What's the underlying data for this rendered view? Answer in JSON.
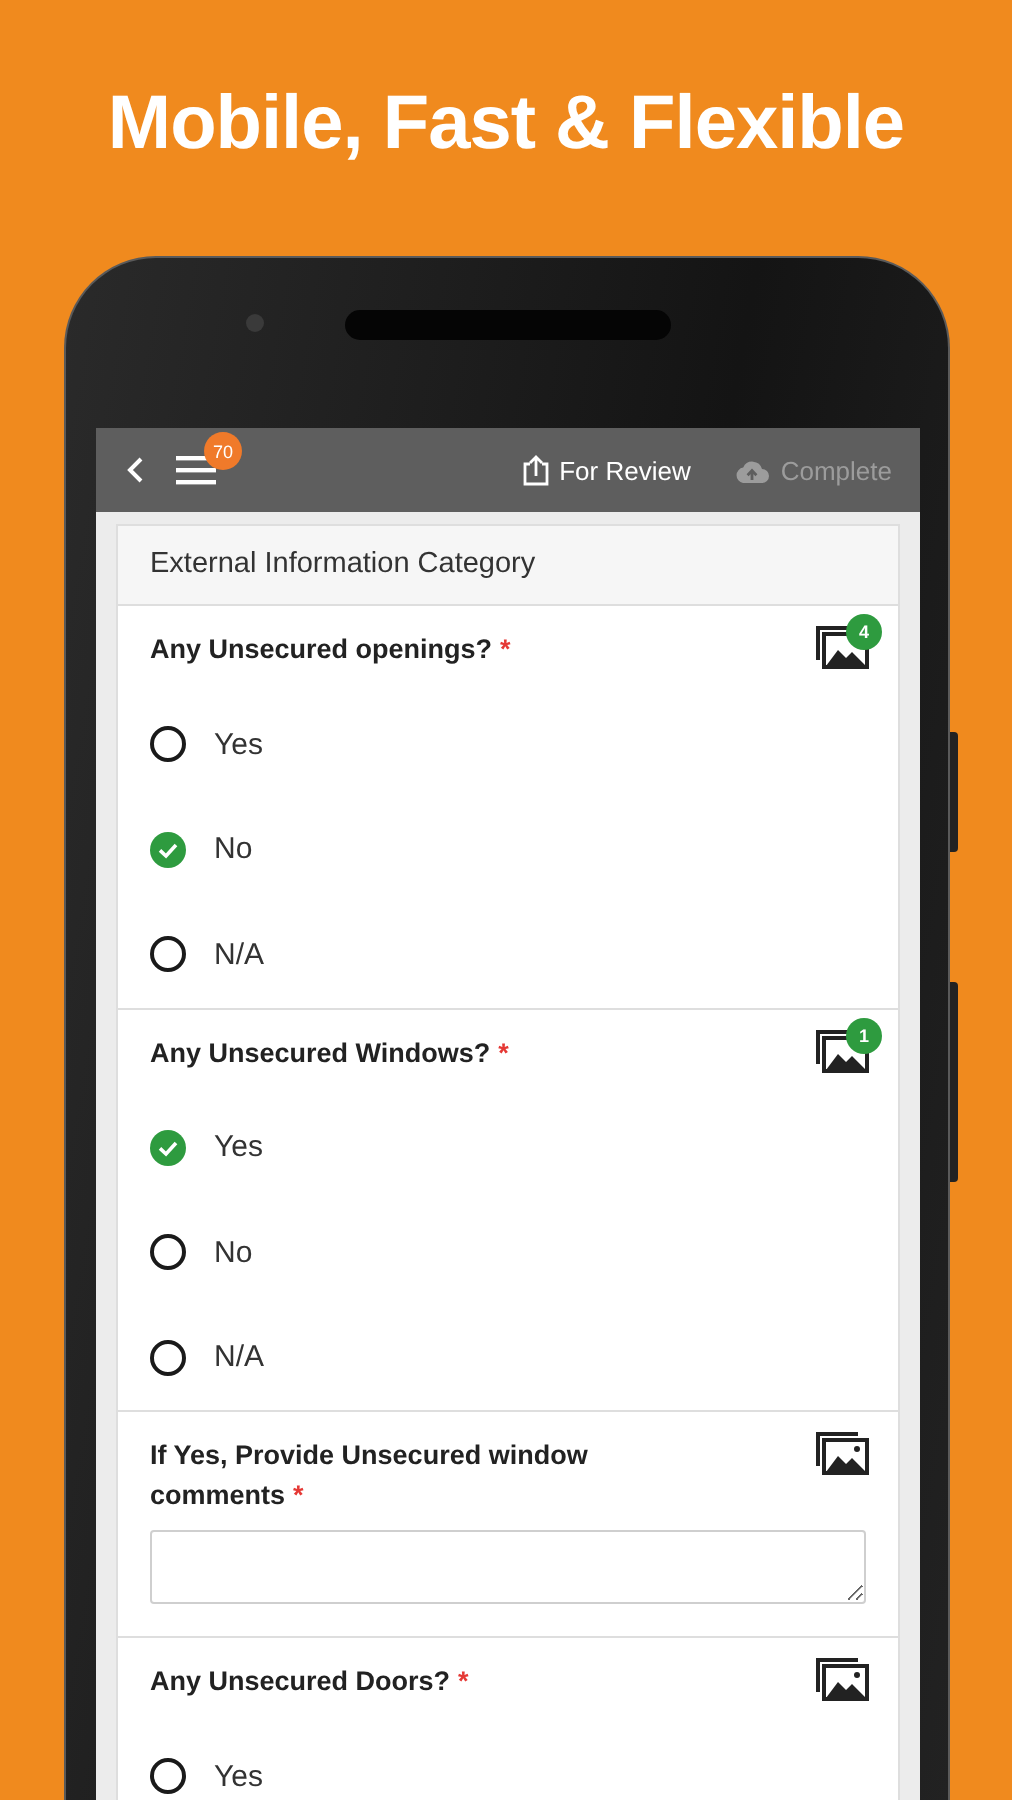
{
  "headline": "Mobile, Fast & Flexible",
  "toolbar": {
    "menu_badge": "70",
    "actions": [
      {
        "kind": "review",
        "label": "For Review",
        "disabled": false
      },
      {
        "kind": "complete",
        "label": "Complete",
        "disabled": true
      }
    ]
  },
  "category": "External Information Category",
  "questions": [
    {
      "kind": "choice",
      "label": "Any Unsecured openings?",
      "required_mark": "*",
      "photo_count": "4",
      "options": [
        {
          "label": "Yes",
          "selected": false
        },
        {
          "label": "No",
          "selected": true
        },
        {
          "label": "N/A",
          "selected": false
        }
      ]
    },
    {
      "kind": "choice",
      "label": "Any Unsecured Windows?",
      "required_mark": "*",
      "photo_count": "1",
      "options": [
        {
          "label": "Yes",
          "selected": true
        },
        {
          "label": "No",
          "selected": false
        },
        {
          "label": "N/A",
          "selected": false
        }
      ]
    },
    {
      "kind": "text",
      "label": "If Yes, Provide Unsecured window comments",
      "required_mark": "*"
    },
    {
      "kind": "choice",
      "label": "Any Unsecured Doors?",
      "required_mark": "*",
      "options": [
        {
          "label": "Yes",
          "selected": false
        }
      ]
    }
  ]
}
